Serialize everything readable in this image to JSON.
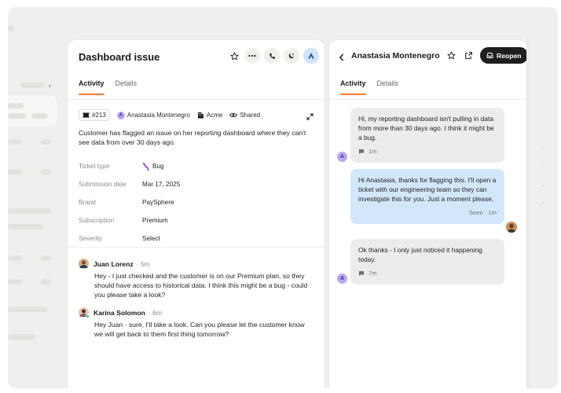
{
  "left_panel": {
    "title": "Dashboard issue",
    "tabs": [
      {
        "label": "Activity",
        "active": true
      },
      {
        "label": "Details",
        "active": false
      }
    ],
    "meta": {
      "ticket_number": "#213",
      "assignee": "Anastasia Montenegro",
      "assignee_initial": "A",
      "company": "Acme",
      "visibility": "Shared"
    },
    "description": "Customer has flagged an issue on her reporting dashboard where they can't see data from over 30 days ago.",
    "properties": [
      {
        "key": "Ticket type",
        "value": "Bug"
      },
      {
        "key": "Submission date",
        "value": "Mar 17, 2025"
      },
      {
        "key": "Brand",
        "value": "PaySphere"
      },
      {
        "key": "Subscription",
        "value": "Premium"
      },
      {
        "key": "Severity",
        "value": "Select"
      }
    ],
    "comments": [
      {
        "author": "Juan Lorenz",
        "time": "· 5m",
        "body": "Hey - I just checked and the customer is on our Premium plan, so they should have access to historical data. I think this might be a bug - could you please take a look?"
      },
      {
        "author": "Karina Solomon",
        "time": "· 6m",
        "body": "Hey Juan - sure, I'll take a look. Can you please let the customer know we will get back to them first thing tomorrow?"
      }
    ]
  },
  "right_panel": {
    "title": "Anastasia Montenegro",
    "reopen_label": "Reopen",
    "tabs": [
      {
        "label": "Activity",
        "active": true
      },
      {
        "label": "Details",
        "active": false
      }
    ],
    "messages": [
      {
        "from": "customer",
        "initial": "A",
        "text": "Hi, my reporting dashboard isn't pulling in data from more than 30 days ago. I think it might be a bug.",
        "time": "1m"
      },
      {
        "from": "agent",
        "text": "Hi Anastasia, thanks for flagging this. I'll open a ticket with our engineering team so they can investigate this for you. Just a moment please.",
        "time": "Seen · 1m"
      },
      {
        "from": "customer",
        "initial": "A",
        "text": "Ok thanks - I only just noticed it happening today.",
        "time": "7m"
      }
    ]
  },
  "colors": {
    "accent_tab": "#f27a35",
    "agent_bubble": "#d3e7fb",
    "customer_bubble": "#ececea",
    "reopen_button": "#1e1e1e",
    "avatar_purple": "#bba7f0"
  }
}
